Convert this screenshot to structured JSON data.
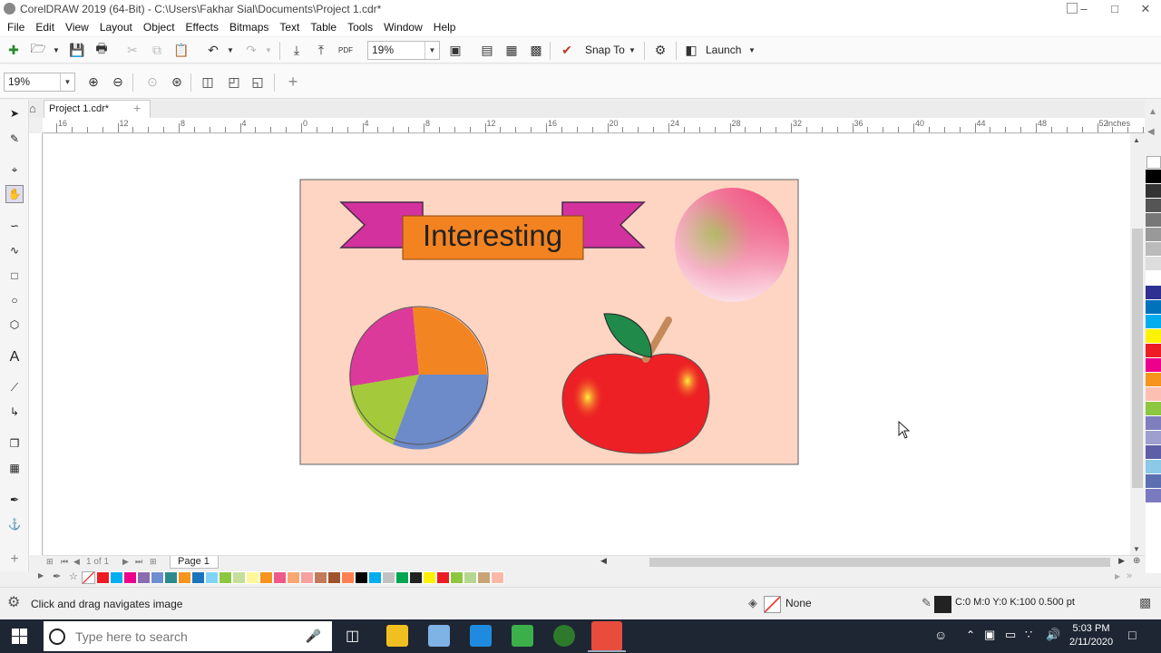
{
  "window": {
    "title": "CorelDRAW 2019 (64-Bit) - C:\\Users\\Fakhar Sial\\Documents\\Project 1.cdr*"
  },
  "menu": [
    "File",
    "Edit",
    "View",
    "Layout",
    "Object",
    "Effects",
    "Bitmaps",
    "Text",
    "Table",
    "Tools",
    "Window",
    "Help"
  ],
  "toolbar": {
    "zoom_value": "19%",
    "snap_label": "Snap To",
    "launch_label": "Launch",
    "pdf_label": "PDF"
  },
  "property_bar": {
    "zoom_value": "19%"
  },
  "document_tab": {
    "name": "Project 1.cdr*"
  },
  "ruler": {
    "labels": [
      "16",
      "12",
      "8",
      "4",
      "0",
      "4",
      "8",
      "12",
      "16",
      "20",
      "24",
      "28",
      "32",
      "36",
      "40",
      "44",
      "48",
      "52"
    ],
    "unit": "inches"
  },
  "artwork": {
    "banner_text": "Interesting"
  },
  "page_nav": {
    "counter": "1 of 1",
    "page_tab": "Page 1"
  },
  "colors": {
    "palette": [
      "#000000",
      "#333333",
      "#555555",
      "#777777",
      "#999999",
      "#bbbbbb",
      "#dddddd",
      "#ffffff",
      "#2e3192",
      "#0072bc",
      "#00aeef",
      "#fff200",
      "#ed1c24",
      "#ec008c",
      "#f7941d",
      "#fdbfb2",
      "#8dc63f",
      "#7f7fbf",
      "#9e9ecf",
      "#5e5ea8",
      "#8cc8e8",
      "#5c6fb1",
      "#7a7ac0"
    ],
    "doc_palette": [
      "#ed1c24",
      "#00aeef",
      "#ec008c",
      "#8c6bb1",
      "#6f8ed0",
      "#2e8b8b",
      "#f7941d",
      "#1b75bb",
      "#7fd3f7",
      "#8dc63f",
      "#c4df9b",
      "#fff799",
      "#f7941d",
      "#ed5a8a",
      "#f9a770",
      "#f6a0a0",
      "#c3795c",
      "#a0522d",
      "#ff7f50",
      "#000000",
      "#00aeef",
      "#c2c2c2",
      "#00a651",
      "#222222",
      "#fff200",
      "#ed1c24",
      "#8dc63f",
      "#b5d78f",
      "#c8a477",
      "#fbb8a8"
    ],
    "accent": "#d83b01"
  },
  "status": {
    "hint": "Click and drag navigates image",
    "fill_label": "None",
    "outline_label": "C:0 M:0 Y:0 K:100  0.500 pt"
  },
  "taskbar": {
    "search_placeholder": "Type here to search",
    "time": "5:03 PM",
    "date": "2/11/2020"
  }
}
